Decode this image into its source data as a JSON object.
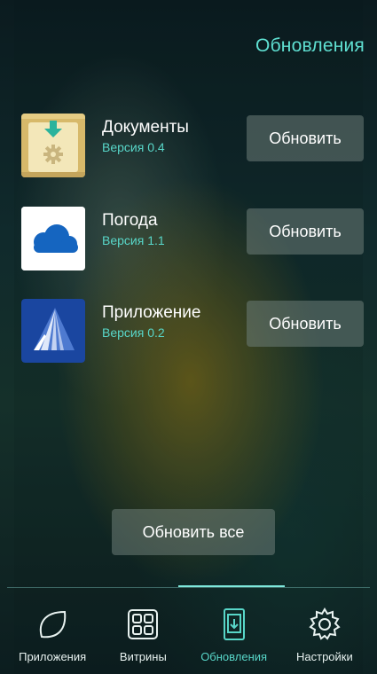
{
  "header": {
    "title": "Обновления"
  },
  "apps": [
    {
      "name": "Документы",
      "version": "Версия 0.4",
      "button": "Обновить",
      "icon": "documents-settings-icon"
    },
    {
      "name": "Погода",
      "version": "Версия 1.1",
      "button": "Обновить",
      "icon": "cloud-icon"
    },
    {
      "name": "Приложение",
      "version": "Версия 0.2",
      "button": "Обновить",
      "icon": "app-logo-icon"
    }
  ],
  "update_all_label": "Обновить все",
  "nav": {
    "items": [
      {
        "label": "Приложения",
        "icon": "leaf-icon",
        "active": false
      },
      {
        "label": "Витрины",
        "icon": "grid-icon",
        "active": false
      },
      {
        "label": "Обновления",
        "icon": "tablet-download-icon",
        "active": true
      },
      {
        "label": "Настройки",
        "icon": "gear-icon",
        "active": false
      }
    ]
  },
  "colors": {
    "accent": "#58d6c8",
    "button_bg": "#6e7d78"
  }
}
